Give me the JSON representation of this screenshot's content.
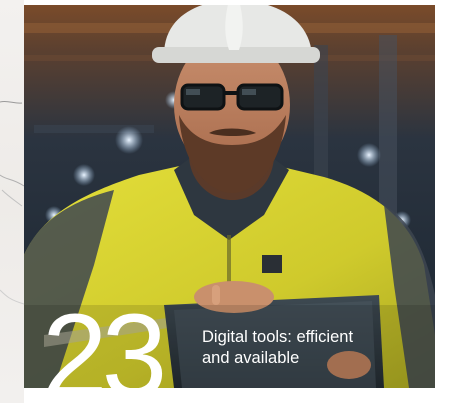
{
  "card": {
    "issue_number": "23",
    "headline_line1": "Digital tools: efficient",
    "headline_line2": "and available"
  },
  "colors": {
    "jacket": "#d8d431",
    "helmet": "#e7e8e6",
    "text": "#ffffff",
    "background_dark": "#1d2a35"
  }
}
